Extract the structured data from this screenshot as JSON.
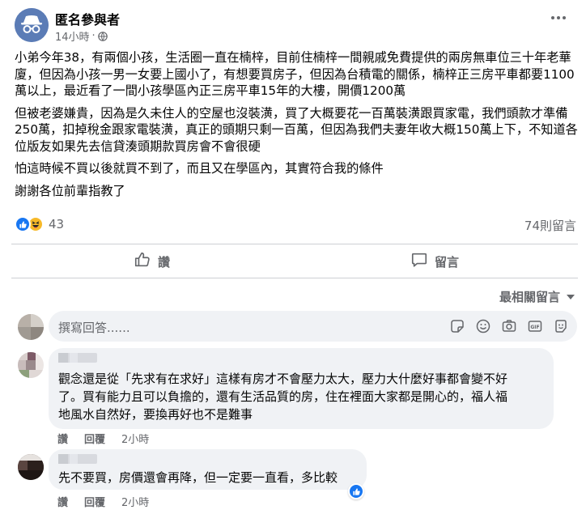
{
  "post": {
    "author": "匿名參與者",
    "time": "14小時",
    "separator": "·",
    "paragraphs": [
      "小弟今年38，有兩個小孩，生活圈一直在楠梓，目前住楠梓一間親戚免費提供的兩房無車位三十年老華廈，但因為小孩一男一女要上國小了，有想要買房子，但因為台積電的關係，楠梓正三房平車都要1100萬以上，最近看了一間小孩學區內正三房平車15年的大樓，開價1200萬",
      "但被老婆嫌貴，因為是久未住人的空屋也沒裝潢，買了大概要花一百萬裝潢跟買家電，我們頭款才準備250萬，扣掉稅金跟家電裝潢，真正的頭期只剩一百萬，但因為我們夫妻年收大概150萬上下，不知道各位版友如果先去信貸湊頭期款買房會不會很硬",
      "怕這時候不買以後就買不到了，而且又在學區內，其實符合我的條件",
      "謝謝各位前輩指教了"
    ],
    "reaction_count": "43",
    "comment_count": "74則留言"
  },
  "actions": {
    "like_label": "讚",
    "comment_label": "留言"
  },
  "sort_label": "最相關留言",
  "compose": {
    "placeholder": "撰寫回答......"
  },
  "comments": [
    {
      "text_lines": [
        "觀念還是從「先求有在求好」這樣有房才不會壓力太大，壓力大什麼好事都會變不好",
        "了。買有能力且可以負擔的，還有生活品質的房，住在裡面大家都是開心的，福人福",
        "地風水自然好，要換再好也不是難事"
      ],
      "like_label": "讚",
      "reply_label": "回覆",
      "time": "2小時"
    },
    {
      "text_lines": [
        "先不要買，房價還會再降，但一定要一直看，多比較"
      ],
      "like_label": "讚",
      "reply_label": "回覆",
      "time": "2小時"
    }
  ],
  "colors": {
    "facebook_blue": "#1877f2",
    "secondary_text": "#65676b",
    "bubble_bg": "#f0f2f5"
  },
  "icons": [
    "incognito-avatar-icon",
    "globe-icon",
    "more-icon",
    "like-icon",
    "haha-icon",
    "thumb-up-outline-icon",
    "comment-bubble-icon",
    "caret-down-icon",
    "sticker-icon",
    "emoji-icon",
    "camera-icon",
    "gif-icon",
    "avatar-sticker-icon"
  ]
}
